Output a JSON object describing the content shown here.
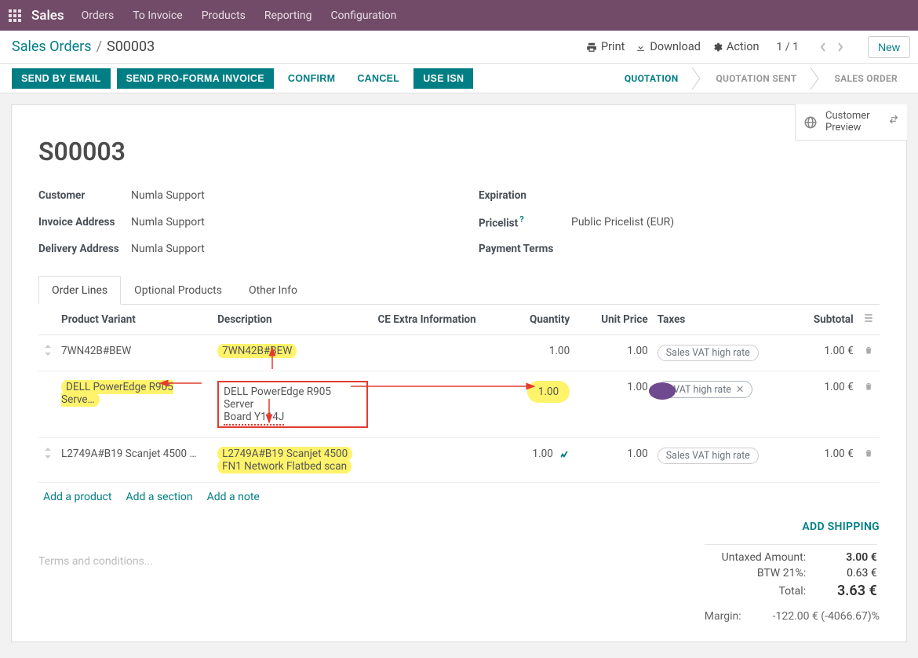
{
  "nav": {
    "app_name": "Sales",
    "links": [
      "Orders",
      "To Invoice",
      "Products",
      "Reporting",
      "Configuration"
    ]
  },
  "ctrl": {
    "crumb_root": "Sales Orders",
    "crumb_current": "S00003",
    "print": "Print",
    "download": "Download",
    "action": "Action",
    "pager": "1 / 1",
    "new": "New"
  },
  "statusbar": {
    "buttons": {
      "send_email": "SEND BY EMAIL",
      "send_proforma": "SEND PRO-FORMA INVOICE",
      "confirm": "CONFIRM",
      "cancel": "CANCEL",
      "use_isn": "USE ISN"
    },
    "stages": {
      "quotation": "QUOTATION",
      "quotation_sent": "QUOTATION SENT",
      "sales_order": "SALES ORDER"
    }
  },
  "customer_preview": {
    "line1": "Customer",
    "line2": "Preview"
  },
  "record": {
    "name": "S00003",
    "fields_left": {
      "customer_label": "Customer",
      "customer_value": "Numla Support",
      "invoice_addr_label": "Invoice Address",
      "invoice_addr_value": "Numla Support",
      "delivery_addr_label": "Delivery Address",
      "delivery_addr_value": "Numla Support"
    },
    "fields_right": {
      "expiration_label": "Expiration",
      "expiration_value": "",
      "pricelist_label": "Pricelist",
      "pricelist_value": "Public Pricelist (EUR)",
      "payment_terms_label": "Payment Terms",
      "payment_terms_value": ""
    }
  },
  "tabs": {
    "order_lines": "Order Lines",
    "optional_products": "Optional Products",
    "other_info": "Other Info"
  },
  "table": {
    "headers": {
      "product": "Product Variant",
      "description": "Description",
      "extra": "CE Extra Information",
      "qty": "Quantity",
      "unit_price": "Unit Price",
      "taxes": "Taxes",
      "subtotal": "Subtotal"
    },
    "rows": [
      {
        "product": "7WN42B#BEW",
        "description": "7WN42B#BEW",
        "qty": "1.00",
        "unit_price": "1.00",
        "tax": "Sales VAT high rate",
        "subtotal": "1.00 €"
      },
      {
        "product": "DELL PowerEdge R905 Serve…",
        "description_line1": "DELL PowerEdge R905 Server",
        "description_line2": "Board Y114J",
        "qty": "1.00",
        "unit_price": "1.00",
        "tax": "s VAT high rate",
        "subtotal": "1.00 €"
      },
      {
        "product": "L2749A#B19 Scanjet 4500 F…",
        "description_line1": "L2749A#B19 Scanjet 4500",
        "description_line2": "FN1 Network Flatbed scan",
        "qty": "1.00",
        "unit_price": "1.00",
        "tax": "Sales VAT high rate",
        "subtotal": "1.00 €"
      }
    ],
    "add_links": {
      "product": "Add a product",
      "section": "Add a section",
      "note": "Add a note"
    }
  },
  "footer": {
    "add_shipping": "ADD SHIPPING",
    "terms_placeholder": "Terms and conditions...",
    "untaxed_label": "Untaxed Amount:",
    "untaxed_value": "3.00 €",
    "btw_label": "BTW 21%:",
    "btw_value": "0.63 €",
    "total_label": "Total:",
    "total_value": "3.63 €",
    "margin_label": "Margin:",
    "margin_value": "-122.00 € (-4066.67)%"
  }
}
